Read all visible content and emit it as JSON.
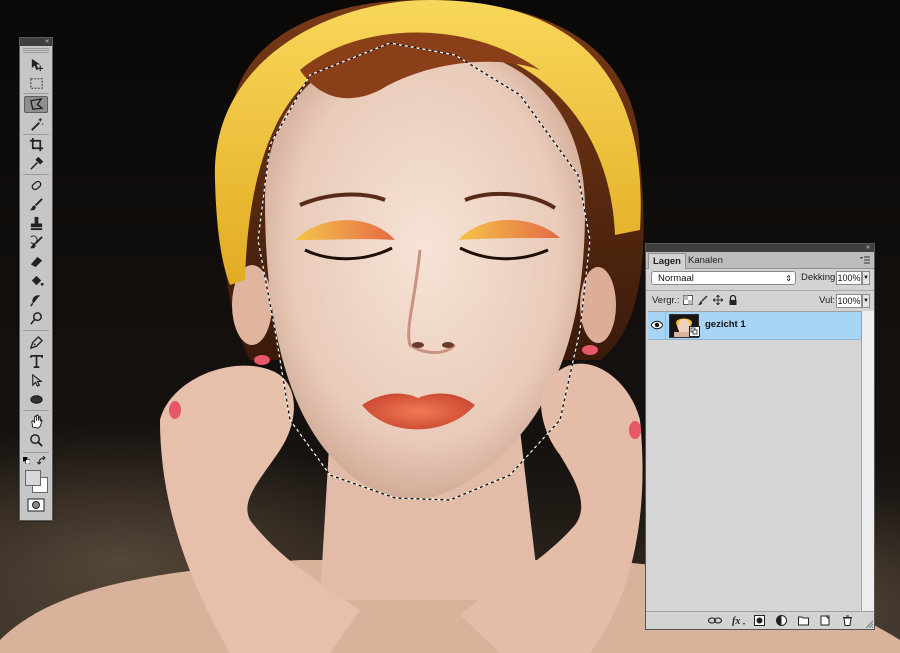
{
  "tools_panel": {
    "tools": [
      {
        "name": "move-tool-icon"
      },
      {
        "name": "rectangular-marquee-tool-icon"
      },
      {
        "name": "polygonal-lasso-tool-icon",
        "active": true
      },
      {
        "name": "magic-wand-tool-icon"
      },
      {
        "name": "crop-tool-icon"
      },
      {
        "name": "eyedropper-tool-icon"
      },
      {
        "name": "spot-healing-brush-tool-icon"
      },
      {
        "name": "brush-tool-icon"
      },
      {
        "name": "clone-stamp-tool-icon"
      },
      {
        "name": "history-brush-tool-icon"
      },
      {
        "name": "eraser-tool-icon"
      },
      {
        "name": "paint-bucket-tool-icon"
      },
      {
        "name": "burn-tool-icon"
      },
      {
        "name": "sponge-tool-icon"
      },
      {
        "name": "pen-tool-icon"
      },
      {
        "name": "type-tool-icon"
      },
      {
        "name": "path-selection-tool-icon"
      },
      {
        "name": "ellipse-tool-icon"
      },
      {
        "name": "hand-tool-icon"
      },
      {
        "name": "zoom-tool-icon"
      }
    ],
    "foreground_color": "#d7d7d7",
    "background_color": "#ffffff"
  },
  "layers_panel": {
    "tabs": [
      {
        "label": "Lagen",
        "active": true
      },
      {
        "label": "Kanalen",
        "active": false
      }
    ],
    "blend_mode": "Normaal",
    "opacity_label": "Dekking:",
    "opacity_value": "100%",
    "lock_label": "Vergr.:",
    "fill_label": "Vul:",
    "fill_value": "100%",
    "layers": [
      {
        "name": "gezicht 1",
        "visible": true,
        "selected": true,
        "smart_object": true
      }
    ],
    "selected_row_color": "#a8d4f5"
  },
  "canvas": {
    "has_selection": true,
    "headband_color": "#f2c23a"
  }
}
